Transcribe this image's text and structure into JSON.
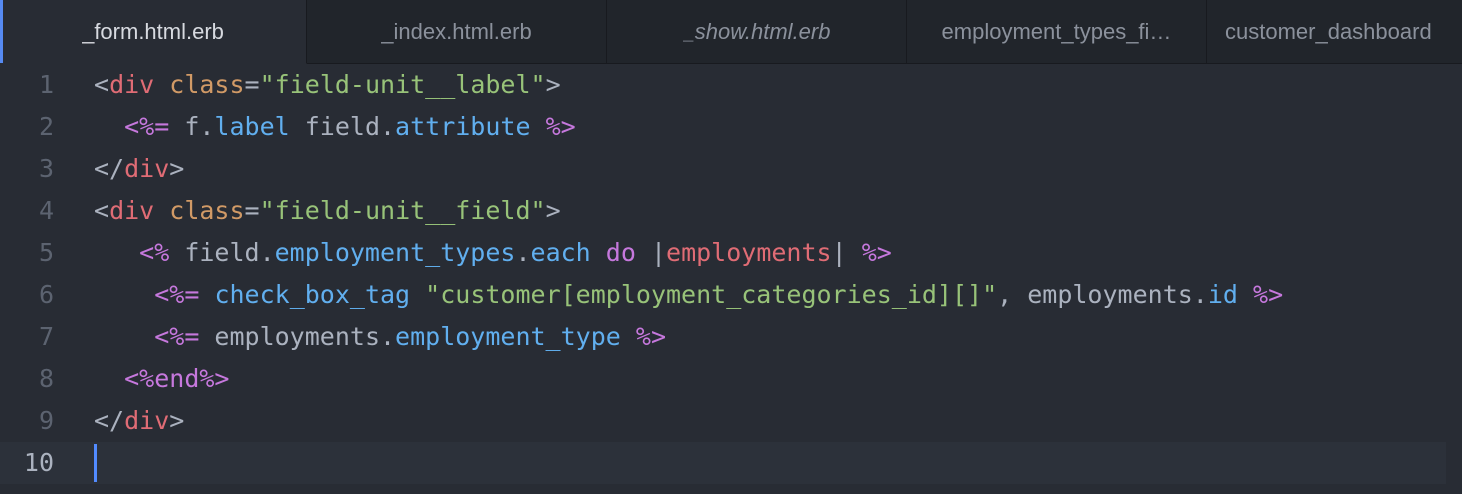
{
  "tabs": [
    {
      "label": "_form.html.erb",
      "active": true
    },
    {
      "label": "_index.html.erb",
      "active": false
    },
    {
      "label": "_show.html.erb",
      "active": false,
      "italic": true
    },
    {
      "label": "employment_types_fi…",
      "active": false
    },
    {
      "label": "customer_dashboard",
      "active": false
    }
  ],
  "code": {
    "line_numbers": [
      "1",
      "2",
      "3",
      "4",
      "5",
      "6",
      "7",
      "8",
      "9",
      "10"
    ],
    "cursor_line": 10,
    "lines": [
      [
        {
          "t": "<",
          "c": "punct"
        },
        {
          "t": "div",
          "c": "tag"
        },
        {
          "t": " ",
          "c": "plain"
        },
        {
          "t": "class",
          "c": "attr"
        },
        {
          "t": "=",
          "c": "punct"
        },
        {
          "t": "\"field-unit__label\"",
          "c": "str"
        },
        {
          "t": ">",
          "c": "punct"
        }
      ],
      [
        {
          "t": "  ",
          "c": "plain"
        },
        {
          "t": "<%=",
          "c": "erb"
        },
        {
          "t": " f.",
          "c": "plain"
        },
        {
          "t": "label",
          "c": "meth"
        },
        {
          "t": " field.",
          "c": "plain"
        },
        {
          "t": "attribute",
          "c": "meth"
        },
        {
          "t": " ",
          "c": "plain"
        },
        {
          "t": "%>",
          "c": "erb"
        }
      ],
      [
        {
          "t": "</",
          "c": "punct"
        },
        {
          "t": "div",
          "c": "tag"
        },
        {
          "t": ">",
          "c": "punct"
        }
      ],
      [
        {
          "t": "<",
          "c": "punct"
        },
        {
          "t": "div",
          "c": "tag"
        },
        {
          "t": " ",
          "c": "plain"
        },
        {
          "t": "class",
          "c": "attr"
        },
        {
          "t": "=",
          "c": "punct"
        },
        {
          "t": "\"field-unit__field\"",
          "c": "str"
        },
        {
          "t": ">",
          "c": "punct"
        }
      ],
      [
        {
          "t": "   ",
          "c": "plain"
        },
        {
          "t": "<%",
          "c": "erb"
        },
        {
          "t": " field.",
          "c": "plain"
        },
        {
          "t": "employment_types",
          "c": "meth"
        },
        {
          "t": ".",
          "c": "plain"
        },
        {
          "t": "each",
          "c": "meth"
        },
        {
          "t": " ",
          "c": "plain"
        },
        {
          "t": "do",
          "c": "kw"
        },
        {
          "t": " |",
          "c": "plain"
        },
        {
          "t": "employments",
          "c": "var"
        },
        {
          "t": "| ",
          "c": "plain"
        },
        {
          "t": "%>",
          "c": "erb"
        }
      ],
      [
        {
          "t": "    ",
          "c": "plain"
        },
        {
          "t": "<%=",
          "c": "erb"
        },
        {
          "t": " ",
          "c": "plain"
        },
        {
          "t": "check_box_tag",
          "c": "meth"
        },
        {
          "t": " ",
          "c": "plain"
        },
        {
          "t": "\"customer[employment_categories_id][]\"",
          "c": "str"
        },
        {
          "t": ", employments.",
          "c": "plain"
        },
        {
          "t": "id",
          "c": "meth"
        },
        {
          "t": " ",
          "c": "plain"
        },
        {
          "t": "%>",
          "c": "erb"
        }
      ],
      [
        {
          "t": "    ",
          "c": "plain"
        },
        {
          "t": "<%=",
          "c": "erb"
        },
        {
          "t": " employments.",
          "c": "plain"
        },
        {
          "t": "employment_type",
          "c": "meth"
        },
        {
          "t": " ",
          "c": "plain"
        },
        {
          "t": "%>",
          "c": "erb"
        }
      ],
      [
        {
          "t": "  ",
          "c": "plain"
        },
        {
          "t": "<%",
          "c": "erb"
        },
        {
          "t": "end",
          "c": "kw"
        },
        {
          "t": "%>",
          "c": "erb"
        }
      ],
      [
        {
          "t": "</",
          "c": "punct"
        },
        {
          "t": "div",
          "c": "tag"
        },
        {
          "t": ">",
          "c": "punct"
        }
      ],
      []
    ]
  },
  "colors": {
    "background": "#282c34",
    "tab_bar": "#21252b",
    "accent": "#568af2"
  }
}
